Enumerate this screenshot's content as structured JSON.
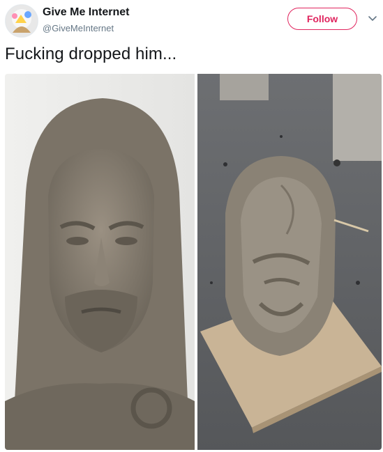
{
  "tweet": {
    "author_name": "Give Me Internet",
    "author_handle": "@GiveMeInternet",
    "follow_label": "Follow",
    "text": "Fucking dropped him..."
  },
  "icons": {
    "chevron": "chevron-down-icon",
    "avatar": "avatar"
  },
  "media": {
    "photos": [
      {
        "description_name": "clay-bust-intact-photo"
      },
      {
        "description_name": "clay-bust-dropped-photo"
      }
    ]
  },
  "colors": {
    "accent": "#e0245e",
    "handle": "#657786",
    "text": "#14171a"
  }
}
